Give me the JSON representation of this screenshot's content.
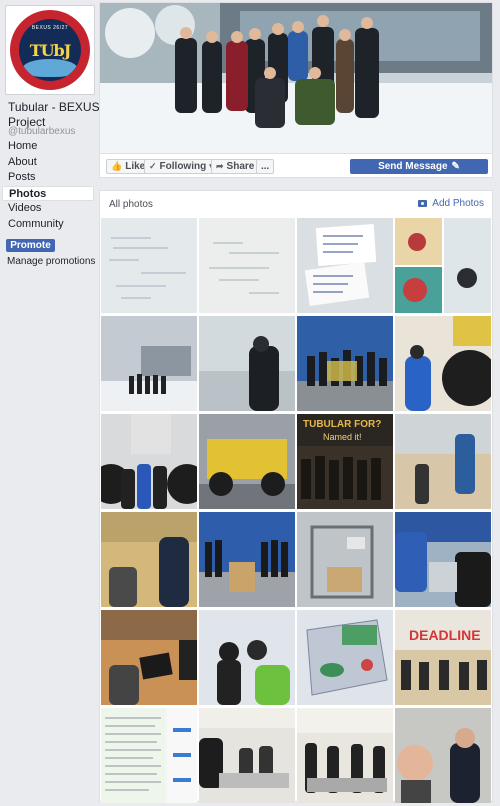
{
  "page": {
    "name": "Tubular - BEXUS Project",
    "handle": "@tubularbexus",
    "logo_text": "TUbJ",
    "logo_top_text": "BEXUS 26/27"
  },
  "nav": {
    "items": [
      {
        "label": "Home",
        "active": false
      },
      {
        "label": "About",
        "active": false
      },
      {
        "label": "Posts",
        "active": false
      },
      {
        "label": "Photos",
        "active": true
      },
      {
        "label": "Videos",
        "active": false
      },
      {
        "label": "Community",
        "active": false
      }
    ],
    "promote_label": "Promote",
    "manage_label": "Manage promotions"
  },
  "actions": {
    "like_label": "Like",
    "following_label": "Following",
    "share_label": "Share",
    "more_label": "...",
    "send_message_label": "Send Message"
  },
  "photos": {
    "title": "All photos",
    "add_label": "Add Photos",
    "thumb_text": {
      "tubular_sign": "TUBULAR FOR?",
      "named_it": "Named it!",
      "deadline": "DEADLINE"
    }
  },
  "colors": {
    "accent": "#4267b2",
    "background": "#e9ebee",
    "panel": "#ffffff"
  },
  "icons": [
    "thumbs-up-icon",
    "check-icon",
    "share-arrow-icon",
    "pencil-icon",
    "camera-icon"
  ]
}
